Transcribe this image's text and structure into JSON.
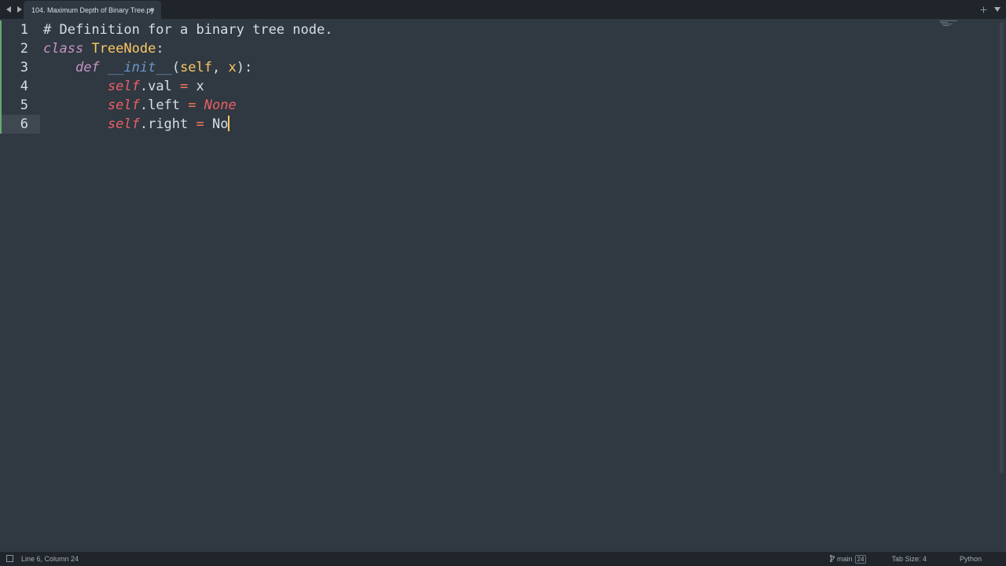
{
  "tab": {
    "title": "104. Maximum Depth of Binary Tree.py",
    "dirty": true
  },
  "icons": {
    "back": "chevron-left-icon",
    "forward": "chevron-right-icon",
    "new_tab": "plus-icon",
    "tab_list": "chevron-down-icon",
    "panel": "panel-toggle-icon",
    "branch": "git-branch-icon"
  },
  "editor": {
    "current_line": 6,
    "modified_lines": [
      1,
      2,
      3,
      4,
      5,
      6
    ],
    "lines": [
      {
        "number": "1",
        "tokens": [
          {
            "t": "# Definition for a binary tree node.",
            "c": "comment"
          }
        ]
      },
      {
        "number": "2",
        "tokens": [
          {
            "t": "class",
            "c": "keyword"
          },
          {
            "t": " ",
            "c": "plain"
          },
          {
            "t": "TreeNode",
            "c": "classname"
          },
          {
            "t": ":",
            "c": "plain"
          }
        ]
      },
      {
        "number": "3",
        "tokens": [
          {
            "t": "    ",
            "c": "plain"
          },
          {
            "t": "def",
            "c": "keyword"
          },
          {
            "t": " ",
            "c": "plain"
          },
          {
            "t": "__init__",
            "c": "funcname"
          },
          {
            "t": "(",
            "c": "plain"
          },
          {
            "t": "self",
            "c": "selfparam"
          },
          {
            "t": ", ",
            "c": "plain"
          },
          {
            "t": "x",
            "c": "selfparam"
          },
          {
            "t": "):",
            "c": "plain"
          }
        ]
      },
      {
        "number": "4",
        "tokens": [
          {
            "t": "        ",
            "c": "plain"
          },
          {
            "t": "self",
            "c": "self"
          },
          {
            "t": ".val ",
            "c": "plain"
          },
          {
            "t": "=",
            "c": "op"
          },
          {
            "t": " x",
            "c": "plain"
          }
        ]
      },
      {
        "number": "5",
        "tokens": [
          {
            "t": "        ",
            "c": "plain"
          },
          {
            "t": "self",
            "c": "self"
          },
          {
            "t": ".left ",
            "c": "plain"
          },
          {
            "t": "=",
            "c": "op"
          },
          {
            "t": " ",
            "c": "plain"
          },
          {
            "t": "None",
            "c": "const"
          }
        ]
      },
      {
        "number": "6",
        "tokens": [
          {
            "t": "        ",
            "c": "plain"
          },
          {
            "t": "self",
            "c": "self"
          },
          {
            "t": ".right ",
            "c": "plain"
          },
          {
            "t": "=",
            "c": "op"
          },
          {
            "t": " No",
            "c": "plain"
          }
        ]
      }
    ]
  },
  "status": {
    "position": "Line 6, Column 24",
    "branch": "main",
    "branch_badge": "24",
    "tab_size": "Tab Size: 4",
    "syntax": "Python"
  },
  "colors": {
    "background": "#303841",
    "chrome": "#1f252b",
    "keyword": "#c594c5",
    "classname": "#fac863",
    "function": "#6699cc",
    "self": "#ec5f67",
    "operator": "#f97b58",
    "modified_marker": "#6aa872"
  }
}
